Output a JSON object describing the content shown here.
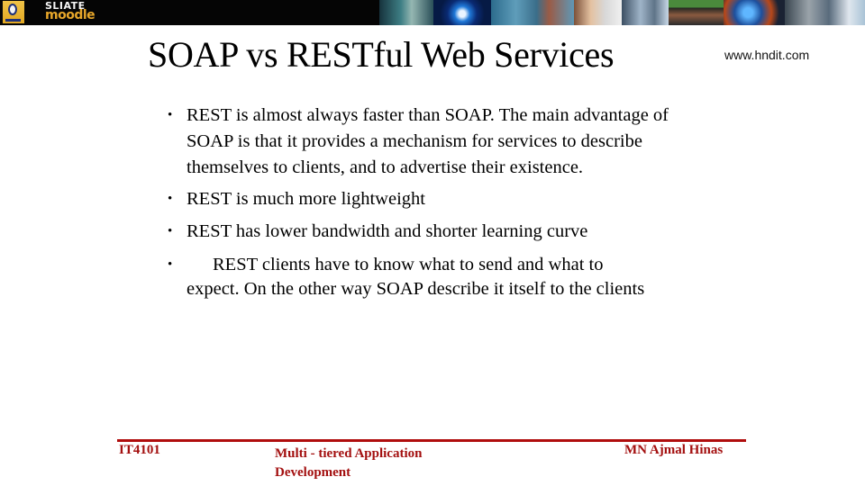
{
  "banner": {
    "logo_icon": "university-crest-icon",
    "brand_line1": "SLIATE",
    "brand_line2": "moodle",
    "images": [
      "robot-image",
      "globe-eye-image",
      "touchscreen-image",
      "students-image",
      "keyboard-image",
      "classroom-image",
      "earth-image",
      "robot-face-image"
    ]
  },
  "slide": {
    "title": "SOAP vs RESTful Web Services",
    "website": "www.hndit.com",
    "bullets": [
      {
        "marker": "•",
        "text": "REST is almost always  faster than SOAP. The main advantage of SOAP is that it provides a mechanism for services to describe themselves to clients, and to advertise their existence."
      },
      {
        "marker": "•",
        "text": "REST is much more lightweight"
      },
      {
        "marker": "•",
        "text": "REST has lower bandwidth and shorter learning curve"
      },
      {
        "marker": "•",
        "text_line1": "REST clients have to know what to send and what to",
        "text_rest": "expect. On the other way SOAP describe it itself to the clients"
      }
    ]
  },
  "footer": {
    "course_code": "IT4101",
    "course_name": "Multi - tiered Application Development",
    "author": "MN Ajmal Hinas",
    "accent_color": "#b00d0d"
  }
}
